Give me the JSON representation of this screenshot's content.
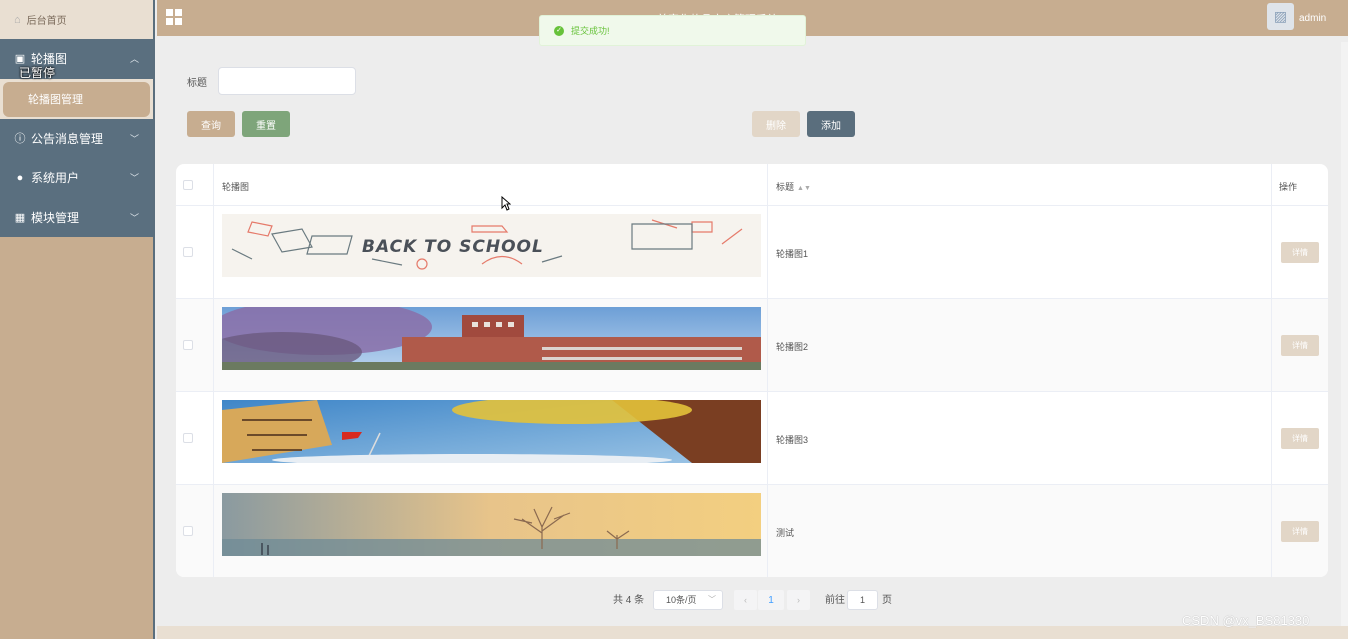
{
  "sidebar": {
    "home": "后台首页",
    "groups": [
      {
        "label": "轮播图",
        "icon": "image-icon",
        "expanded": true,
        "sub": [
          "轮播图管理"
        ]
      },
      {
        "label": "公告消息管理",
        "icon": "info-icon"
      },
      {
        "label": "系统用户",
        "icon": "user-icon"
      },
      {
        "label": "模块管理",
        "icon": "grid-icon"
      }
    ],
    "paused_overlay": "已暂停"
  },
  "header": {
    "title": "美容化妆品商店管理系统",
    "user": "admin"
  },
  "toast": {
    "message": "提交成功!",
    "type": "success"
  },
  "filter": {
    "label": "标题",
    "value": "",
    "placeholder": ""
  },
  "buttons": {
    "query": "查询",
    "reset": "重置",
    "delete": "删除",
    "add": "添加"
  },
  "table": {
    "columns": [
      "轮播图",
      "标题",
      "操作"
    ],
    "rows": [
      {
        "image": "back-to-school-banner",
        "image_text": "BACK TO SCHOOL",
        "title": "轮播图1",
        "action": "详情"
      },
      {
        "image": "campus-building-blossoms",
        "title": "轮播图2",
        "action": "详情"
      },
      {
        "image": "building-flag-autumn-tree",
        "title": "轮播图3",
        "action": "详情"
      },
      {
        "image": "misty-tree-sunset",
        "title": "测试",
        "action": "详情"
      }
    ]
  },
  "pagination": {
    "total": "共 4 条",
    "page_size": "10条/页",
    "current": "1",
    "goto_label": "前往",
    "goto_value": "1",
    "page_suffix": "页"
  },
  "watermark": "CSDN @vx_BS81330",
  "colors": {
    "primary": "#c7ad90",
    "nav": "#5a6e7d",
    "success": "#67c23a",
    "reset": "#7ea57a"
  }
}
